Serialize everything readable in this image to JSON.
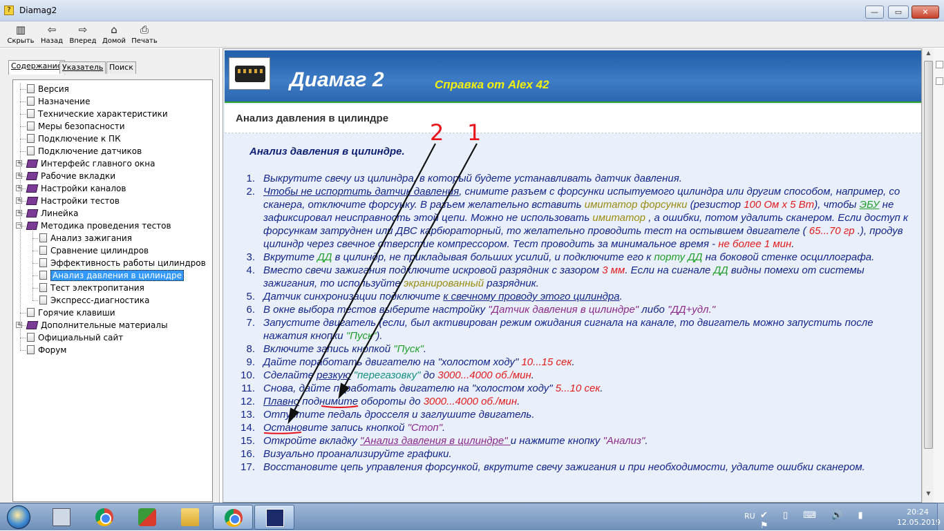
{
  "window": {
    "title": "Diamag2",
    "min_label": "—",
    "max_label": "▭",
    "close_label": "✕"
  },
  "toolbar": [
    {
      "label": "Скрыть",
      "icon": "hide-icon",
      "glyph": "▥"
    },
    {
      "label": "Назад",
      "icon": "back-arrow-icon",
      "glyph": "⇦"
    },
    {
      "label": "Вперед",
      "icon": "forward-arrow-icon",
      "glyph": "⇨"
    },
    {
      "label": "Домой",
      "icon": "home-icon",
      "glyph": "⌂"
    },
    {
      "label": "Печать",
      "icon": "print-icon",
      "glyph": "⎙"
    }
  ],
  "nav": {
    "tabs": [
      "Содержание",
      "Указатель",
      "Поиск"
    ],
    "tree": [
      {
        "label": "Версия",
        "type": "page"
      },
      {
        "label": "Назначение",
        "type": "page"
      },
      {
        "label": "Технические характеристики",
        "type": "page"
      },
      {
        "label": "Меры безопасности",
        "type": "page"
      },
      {
        "label": "Подключение к ПК",
        "type": "page"
      },
      {
        "label": "Подключение датчиков",
        "type": "page"
      },
      {
        "label": "Интерфейс главного окна",
        "type": "book",
        "expander": "+"
      },
      {
        "label": "Рабочие вкладки",
        "type": "book",
        "expander": "+"
      },
      {
        "label": "Настройки каналов",
        "type": "book",
        "expander": "+"
      },
      {
        "label": "Настройки тестов",
        "type": "book",
        "expander": "+"
      },
      {
        "label": "Линейка",
        "type": "book",
        "expander": "+"
      },
      {
        "label": "Методика проведения тестов",
        "type": "book-open",
        "expander": "−"
      },
      {
        "label": "Анализ зажигания",
        "type": "page",
        "child": true
      },
      {
        "label": "Сравнение цилиндров",
        "type": "page",
        "child": true
      },
      {
        "label": "Эффективность работы цилиндров",
        "type": "page",
        "child": true
      },
      {
        "label": "Анализ давления в цилиндре",
        "type": "page",
        "child": true,
        "selected": true
      },
      {
        "label": "Тест электропитания",
        "type": "page",
        "child": true
      },
      {
        "label": "Экспресс-диагностика",
        "type": "page",
        "child": true
      },
      {
        "label": "Горячие клавиши",
        "type": "page"
      },
      {
        "label": "Дополнительные материалы",
        "type": "book",
        "expander": "+"
      },
      {
        "label": "Официальный сайт",
        "type": "page"
      },
      {
        "label": "Форум",
        "type": "page"
      }
    ]
  },
  "content": {
    "app_title": "Диамаг 2",
    "app_subtitle": "Справка от Alex 42",
    "section_title": "Анализ давления в цилиндре",
    "heading": "Анализ давления в цилиндре.",
    "steps": [
      [
        {
          "t": "Выкрутите свечу из цилиндра, в который будете устанавливать датчик давления."
        }
      ],
      [
        {
          "t": "Чтобы не испортить датчик давления",
          "c": "u"
        },
        {
          "t": ", снимите разъем с форсунки испытуемого цилиндра или другим способом, например, со сканера, отключите форсунку. В разъем желательно вставить "
        },
        {
          "t": "имитатор форсунки",
          "c": "olv"
        },
        {
          "t": " (резистор "
        },
        {
          "t": "100 Ом х 5 Вт",
          "c": "red"
        },
        {
          "t": "), чтобы "
        },
        {
          "t": "ЭБУ",
          "c": "grn u"
        },
        {
          "t": " не зафиксировал неисправность этой цепи. Можно не использовать "
        },
        {
          "t": "имитатор",
          "c": "olv"
        },
        {
          "t": " , а ошибки, потом удалить сканером. Если доступ к форсункам затруднен или ДВС карбюраторный, то желательно проводить тест на остывшем двигателе ( "
        },
        {
          "t": "65...70 гр",
          "c": "red"
        },
        {
          "t": " .), продув цилиндр через свечное отверстие компрессором. Тест проводить за минимальное время - "
        },
        {
          "t": "не более 1 мин",
          "c": "red"
        },
        {
          "t": "."
        }
      ],
      [
        {
          "t": "Вкрутите "
        },
        {
          "t": "ДД",
          "c": "grn"
        },
        {
          "t": " в цилиндр, не прикладывая больших усилий, и подключите его к "
        },
        {
          "t": "порту ДД",
          "c": "grn"
        },
        {
          "t": " на боковой стенке осциллографа."
        }
      ],
      [
        {
          "t": "Вместо свечи зажигания подключите искровой разрядник с зазором "
        },
        {
          "t": "3 мм",
          "c": "red"
        },
        {
          "t": ". Если на сигнале "
        },
        {
          "t": "ДД",
          "c": "grn"
        },
        {
          "t": " видны помехи от системы зажигания, то используйте "
        },
        {
          "t": "экранированный",
          "c": "olv"
        },
        {
          "t": " разрядник."
        }
      ],
      [
        {
          "t": "Датчик синхронизации подключите "
        },
        {
          "t": "к свечному проводу этого цилиндра",
          "c": "u"
        },
        {
          "t": "."
        }
      ],
      [
        {
          "t": "В окне выбора тестов выберите настройку "
        },
        {
          "t": "\"Датчик давления в цилиндре\"",
          "c": "pur"
        },
        {
          "t": " либо "
        },
        {
          "t": "\"ДД+удл.\"",
          "c": "pur"
        }
      ],
      [
        {
          "t": "Запустите двигатель (если, был активирован режим ожидания сигнала на канале, то двигатель можно запустить после нажатия кнопки "
        },
        {
          "t": "\"Пуск\"",
          "c": "grn"
        },
        {
          "t": ")."
        }
      ],
      [
        {
          "t": "Включите запись кнопкой "
        },
        {
          "t": "\"Пуск\"",
          "c": "grn"
        },
        {
          "t": "."
        }
      ],
      [
        {
          "t": " Дайте поработать двигателю на \"холостом ходу\" "
        },
        {
          "t": "10...15 сек",
          "c": "red"
        },
        {
          "t": "."
        }
      ],
      [
        {
          "t": "Сделайте "
        },
        {
          "t": "резкую",
          "c": "u"
        },
        {
          "t": " "
        },
        {
          "t": "\"перегазовку\"",
          "c": "teal"
        },
        {
          "t": " до "
        },
        {
          "t": "3000...4000 об./мин",
          "c": "red"
        },
        {
          "t": "."
        }
      ],
      [
        {
          "t": "Снова, дайте поработать двигателю на \"холостом ходу\" "
        },
        {
          "t": "5...10 сек",
          "c": "red"
        },
        {
          "t": "."
        }
      ],
      [
        {
          "t": "Плавно",
          "c": "u"
        },
        {
          "t": " поднимите обороты до "
        },
        {
          "t": "3000...4000 об./мин",
          "c": "red"
        },
        {
          "t": "."
        }
      ],
      [
        {
          "t": "Отпустите педаль дросселя и заглушите двигатель."
        }
      ],
      [
        {
          "t": "Остановите запись кнопкой "
        },
        {
          "t": "\"Стоп\"",
          "c": "pur"
        },
        {
          "t": "."
        }
      ],
      [
        {
          "t": "Откройте вкладку  "
        },
        {
          "t": "\"Анализ давления в цилиндре\" ",
          "c": "pur u"
        },
        {
          "t": "и нажмите кнопку "
        },
        {
          "t": "\"Анализ\"",
          "c": "pur"
        },
        {
          "t": "."
        }
      ],
      [
        {
          "t": "Визуально проанализируйте графики."
        }
      ],
      [
        {
          "t": "Восстановите цепь управления форсункой, вкрутите свечу зажигания и при необходимости, удалите ошибки сканером."
        }
      ]
    ]
  },
  "annotations": {
    "label_1": "1",
    "label_2": "2",
    "color": "#e8141a"
  },
  "taskbar": {
    "apps": [
      {
        "name": "calculator-icon"
      },
      {
        "name": "chrome-icon"
      },
      {
        "name": "app-icon"
      },
      {
        "name": "explorer-icon"
      },
      {
        "name": "chrome-icon",
        "active": true
      },
      {
        "name": "diamag-icon",
        "active": true
      }
    ],
    "lang": "RU",
    "tray_glyphs": "✔ ▯ ⌨ 🔊 ▮ ⚑",
    "time": "20:24",
    "date": "12.05.2019"
  },
  "colors": {
    "banner": "#2c66b0",
    "title_text": "#ffffff",
    "subtitle_text": "#f5f10a",
    "body_text": "#13258a",
    "highlight": "#e21b1b",
    "selection": "#3399ff"
  }
}
